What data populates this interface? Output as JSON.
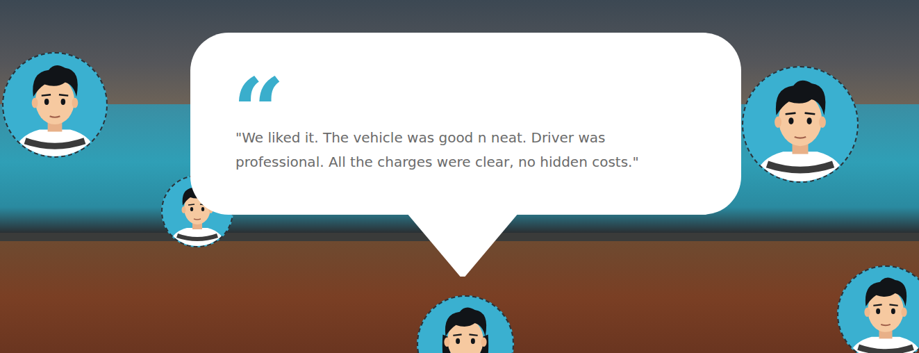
{
  "testimonial": {
    "quote_mark": "“",
    "text": "\"We liked it. The vehicle was good n neat. Driver was professional. All the charges were clear, no hidden costs.\""
  },
  "avatars": [
    {
      "kind": "male",
      "selected": false
    },
    {
      "kind": "male",
      "selected": false
    },
    {
      "kind": "male",
      "selected": false
    },
    {
      "kind": "female",
      "selected": true
    },
    {
      "kind": "male",
      "selected": false
    }
  ]
}
